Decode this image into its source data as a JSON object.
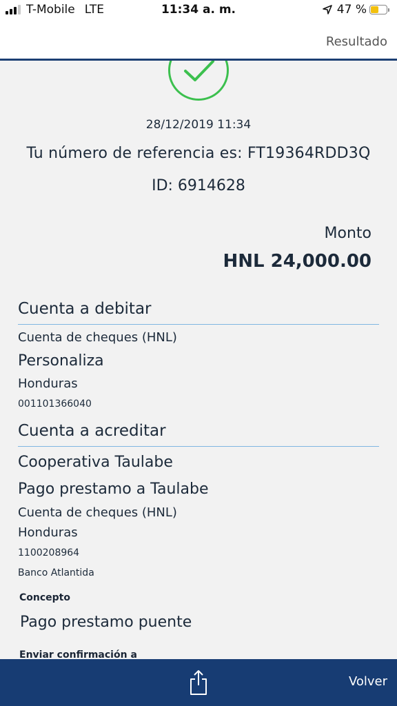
{
  "status_bar": {
    "carrier": "T-Mobile",
    "network": "LTE",
    "time": "11:34 a. m.",
    "battery": "47 %",
    "battery_level": 0.47
  },
  "nav": {
    "title": "Resultado"
  },
  "receipt": {
    "date": "28/12/2019 11:34",
    "reference": "Tu número de referencia es: FT19364RDD3Q",
    "id": "ID: 6914628",
    "amount_label": "Monto",
    "amount": "HNL 24,000.00"
  },
  "debit": {
    "section_title": "Cuenta a debitar",
    "account_type": "Cuenta de cheques (HNL)",
    "name": "Personaliza",
    "country": "Honduras",
    "number": "001101366040"
  },
  "credit": {
    "section_title": "Cuenta a acreditar",
    "name": "Cooperativa Taulabe",
    "description": "Pago prestamo a Taulabe",
    "account_type": "Cuenta de cheques (HNL)",
    "country": "Honduras",
    "number": "1100208964",
    "bank": "Banco Atlantida"
  },
  "concept": {
    "label": "Concepto",
    "value": "Pago prestamo puente"
  },
  "confirmation": {
    "label": "Enviar confirmación a"
  },
  "bottom_bar": {
    "back_label": "Volver",
    "share_icon": "share-icon"
  },
  "colors": {
    "nav_accent": "#1c3f73",
    "success": "#3cc04e",
    "divider": "#7fb6e2",
    "bottom_bar": "#173c73"
  }
}
